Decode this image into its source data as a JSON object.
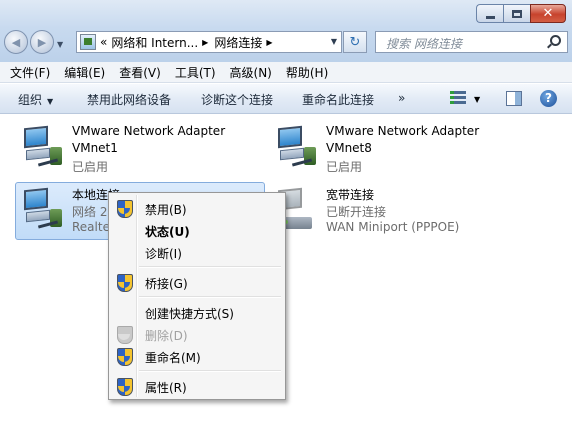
{
  "window": {
    "minimize_label": "",
    "close_glyph": "✕"
  },
  "address_bar": {
    "overflow": "«",
    "crumbs": [
      "网络和 Intern...",
      "网络连接"
    ]
  },
  "search": {
    "placeholder": "搜索 网络连接"
  },
  "menu": [
    "文件(F)",
    "编辑(E)",
    "查看(V)",
    "工具(T)",
    "高级(N)",
    "帮助(H)"
  ],
  "commands": {
    "organize": "组织",
    "disable_device": "禁用此网络设备",
    "diagnose": "诊断这个连接",
    "rename": "重命名此连接",
    "more": "»",
    "help": "?"
  },
  "connections": [
    {
      "name": "VMware Network Adapter",
      "line2": "VMnet1",
      "status": "已启用"
    },
    {
      "name": "VMware Network Adapter",
      "line2": "VMnet8",
      "status": "已启用"
    },
    {
      "name": "本地连接",
      "line2": "网络  2",
      "status": "Realte"
    },
    {
      "name": "宽带连接",
      "line2": "已断开连接",
      "status": "WAN Miniport (PPPOE)"
    }
  ],
  "context_menu": [
    {
      "label": "禁用(B)",
      "icon": "shield-icon"
    },
    {
      "label": "状态(U)",
      "bold": true
    },
    {
      "label": "诊断(I)"
    },
    {
      "label": "桥接(G)",
      "icon": "shield-icon"
    },
    {
      "label": "创建快捷方式(S)"
    },
    {
      "label": "删除(D)",
      "icon": "shield-icon",
      "disabled": true
    },
    {
      "label": "重命名(M)",
      "icon": "shield-icon"
    },
    {
      "label": "属性(R)",
      "icon": "shield-icon"
    }
  ],
  "colors": {
    "selection": "#c1dcf8",
    "menu_bg": "#f5f5f5",
    "disabled_text": "#a0a0a0"
  }
}
